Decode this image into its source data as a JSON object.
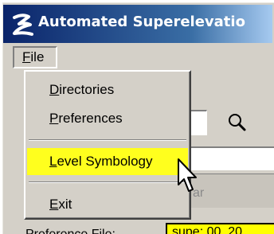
{
  "window": {
    "title": "Automated Superelevatio",
    "icon": "app-logo-icon"
  },
  "menubar": {
    "file_label_first": "F",
    "file_label_rest": "ile"
  },
  "menu": {
    "items": [
      {
        "mnemonic": "D",
        "rest": "irectories"
      },
      {
        "mnemonic": "P",
        "rest": "references"
      },
      {
        "mnemonic": "L",
        "rest": "evel Symbology",
        "highlighted": true,
        "highlight_color": "#ffff1e"
      },
      {
        "mnemonic": "E",
        "rest": "xit"
      }
    ]
  },
  "background": {
    "bar_text": "ar",
    "bottom_label": "Preference File:",
    "bottom_value": "supe: 00_20",
    "bottom_value_color": "#ffff00",
    "search_icon": "search-icon"
  },
  "colors": {
    "title_gradient_start": "#0a246a",
    "title_gradient_end": "#a6caf0",
    "face": "#d4d0c8"
  }
}
